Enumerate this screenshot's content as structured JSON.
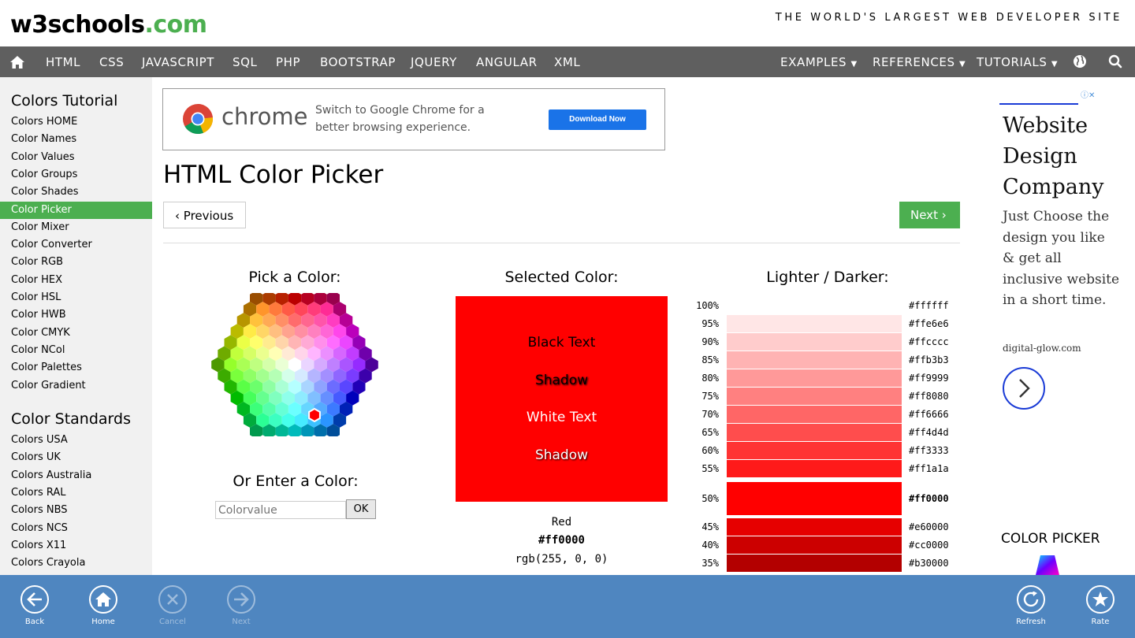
{
  "header": {
    "logo_main": "w3schools",
    "logo_tld": ".com",
    "tagline": "THE WORLD'S LARGEST WEB DEVELOPER SITE"
  },
  "nav": {
    "home_icon": "home-icon",
    "items": [
      "HTML",
      "CSS",
      "JAVASCRIPT",
      "SQL",
      "PHP",
      "BOOTSTRAP",
      "JQUERY",
      "ANGULAR",
      "XML"
    ],
    "right_items": [
      "EXAMPLES",
      "REFERENCES",
      "TUTORIALS"
    ],
    "globe_icon": "globe-icon",
    "search_icon": "search-icon"
  },
  "sidebar": {
    "heading1": "Colors Tutorial",
    "links1": [
      "Colors HOME",
      "Color Names",
      "Color Values",
      "Color Groups",
      "Color Shades",
      "Color Picker",
      "Color Mixer",
      "Color Converter",
      "Color RGB",
      "Color HEX",
      "Color HSL",
      "Color HWB",
      "Color CMYK",
      "Color NCol",
      "Color Palettes",
      "Color Gradient"
    ],
    "active_index": 5,
    "heading2": "Color Standards",
    "links2": [
      "Colors USA",
      "Colors UK",
      "Colors Australia",
      "Colors RAL",
      "Colors NBS",
      "Colors NCS",
      "Colors X11",
      "Colors Crayola"
    ]
  },
  "ad_banner": {
    "brand": "chrome",
    "text": "Switch to Google Chrome for a better browsing experience.",
    "button": "Download Now"
  },
  "main": {
    "title": "HTML Color Picker",
    "prev_label": "Previous",
    "next_label": "Next",
    "pick_heading": "Pick a Color:",
    "enter_heading": "Or Enter a Color:",
    "enter_placeholder": "Colorvalue",
    "ok_label": "OK",
    "selected_heading": "Selected Color:",
    "selected_color": "#ff0000",
    "sample_lines": [
      "Black Text",
      "Shadow",
      "White Text",
      "Shadow"
    ],
    "color_name": "Red",
    "color_hex": "#ff0000",
    "color_rgb": "rgb(255, 0, 0)",
    "shades_heading": "Lighter / Darker:",
    "shades": [
      {
        "pct": "100%",
        "hex": "#ffffff"
      },
      {
        "pct": "95%",
        "hex": "#ffe6e6"
      },
      {
        "pct": "90%",
        "hex": "#ffcccc"
      },
      {
        "pct": "85%",
        "hex": "#ffb3b3"
      },
      {
        "pct": "80%",
        "hex": "#ff9999"
      },
      {
        "pct": "75%",
        "hex": "#ff8080"
      },
      {
        "pct": "70%",
        "hex": "#ff6666"
      },
      {
        "pct": "65%",
        "hex": "#ff4d4d"
      },
      {
        "pct": "60%",
        "hex": "#ff3333"
      },
      {
        "pct": "55%",
        "hex": "#ff1a1a"
      },
      {
        "pct": "50%",
        "hex": "#ff0000"
      },
      {
        "pct": "45%",
        "hex": "#e60000"
      },
      {
        "pct": "40%",
        "hex": "#cc0000"
      },
      {
        "pct": "35%",
        "hex": "#b30000"
      }
    ]
  },
  "right_ad": {
    "title": "Website Design Company",
    "body": "Just Choose the design you like & get all inclusive website in a short time.",
    "domain": "digital-glow.com",
    "arrow_icon": "chevron-right-icon",
    "color_picker_label": "COLOR PICKER"
  },
  "appbar": {
    "buttons": [
      {
        "label": "Back",
        "icon": "back-arrow-icon",
        "enabled": true
      },
      {
        "label": "Home",
        "icon": "home-icon",
        "enabled": true
      },
      {
        "label": "Cancel",
        "icon": "close-icon",
        "enabled": false
      },
      {
        "label": "Next",
        "icon": "forward-arrow-icon",
        "enabled": false
      },
      {
        "label": "Refresh",
        "icon": "refresh-icon",
        "enabled": true
      },
      {
        "label": "Rate",
        "icon": "star-icon",
        "enabled": true
      }
    ]
  }
}
